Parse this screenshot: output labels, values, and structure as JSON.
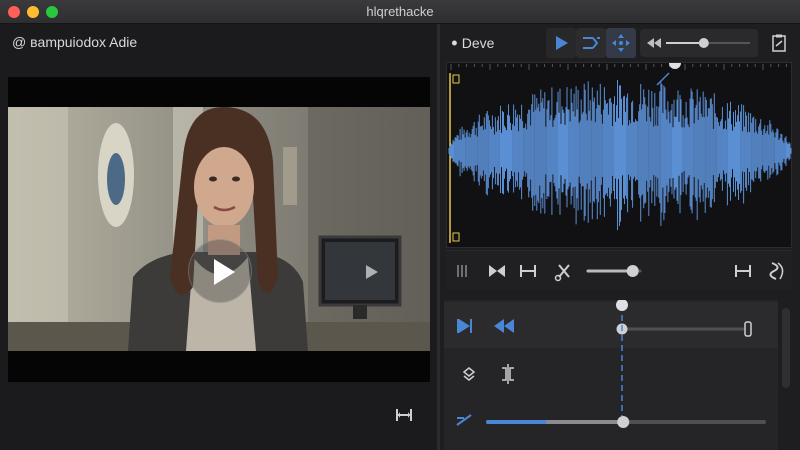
{
  "window": {
    "title": "hlqrethacke"
  },
  "left_panel": {
    "header": "@ ʙampuiodox Adie"
  },
  "right_panel": {
    "tool_label": "ꔷ Deve"
  },
  "icons": {
    "play": "play-icon",
    "fit": "fit-width-icon",
    "shuffle": "shuffle-icon",
    "move": "move-icon",
    "rewind": "rewind-icon",
    "document": "document-icon",
    "pause": "pause-icon",
    "bowtie": "bowtie-icon",
    "cut": "scissors-icon",
    "swirl": "swirl-icon",
    "skip_forward": "skip-forward-icon",
    "layers": "layers-icon",
    "split": "split-icon",
    "pen": "pen-icon"
  },
  "colors": {
    "accent": "#4a86d6",
    "waveform": "#5b8fd4",
    "marker": "#e8c84a"
  },
  "state": {
    "mini_scrub_position": 0.45,
    "volume_level": 0.86,
    "zoom_slider_position": 0.14,
    "progress_slider_level": 0.49
  }
}
